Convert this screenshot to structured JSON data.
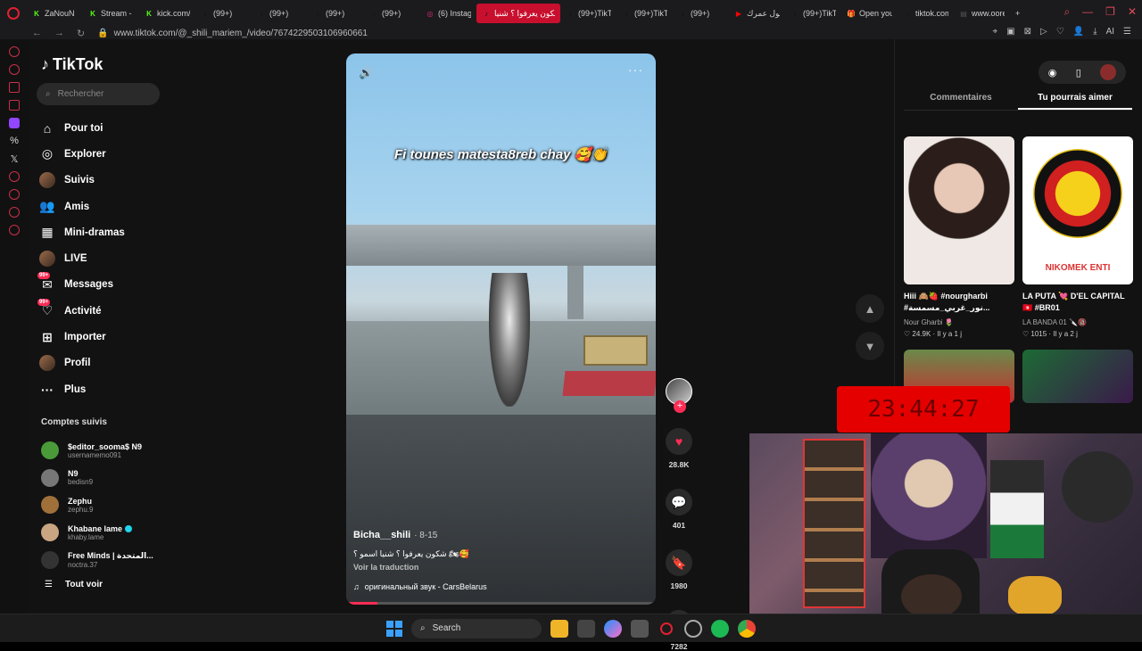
{
  "browser": {
    "tabs": [
      {
        "label": "ZaNouN",
        "fav": "K",
        "color": "#53fc18"
      },
      {
        "label": "Stream - K",
        "fav": "K",
        "color": "#53fc18"
      },
      {
        "label": "kick.com/",
        "fav": "K",
        "color": "#53fc18"
      },
      {
        "label": "(99+)",
        "fav": "♪",
        "color": "#111"
      },
      {
        "label": "(99+)",
        "fav": "♪",
        "color": "#111"
      },
      {
        "label": "(99+)",
        "fav": "♪",
        "color": "#111"
      },
      {
        "label": "(99+)",
        "fav": "♪",
        "color": "#111"
      },
      {
        "label": "(6) Instag",
        "fav": "◎",
        "color": "#d62976"
      },
      {
        "label": "شكون يعرفوا ؟ شنيا",
        "fav": "♪",
        "color": "#111",
        "active": true
      },
      {
        "label": "(99+)TikT",
        "fav": "♪",
        "color": "#111"
      },
      {
        "label": "(99+)TikT",
        "fav": "♪",
        "color": "#111"
      },
      {
        "label": "(99+)",
        "fav": "♪",
        "color": "#111"
      },
      {
        "label": "طول عمرك",
        "fav": "▶",
        "color": "#ff0000"
      },
      {
        "label": "(99+)TikT",
        "fav": "♪",
        "color": "#111"
      },
      {
        "label": "Open you",
        "fav": "🎁",
        "color": "#e33"
      },
      {
        "label": "tiktok.com",
        "fav": "♪",
        "color": "#111"
      },
      {
        "label": "www.oore",
        "fav": "▤",
        "color": "#555"
      }
    ],
    "url": "www.tiktok.com/@_shili_mariem_/video/7674229503106960661"
  },
  "tiktok": {
    "logo": "TikTok",
    "search_placeholder": "Rechercher",
    "nav": [
      {
        "label": "Pour toi",
        "icon": "⌂"
      },
      {
        "label": "Explorer",
        "icon": "◎"
      },
      {
        "label": "Suivis",
        "icon": "avatar"
      },
      {
        "label": "Amis",
        "icon": "👥"
      },
      {
        "label": "Mini-dramas",
        "icon": "▦"
      },
      {
        "label": "LIVE",
        "icon": "avatar"
      },
      {
        "label": "Messages",
        "icon": "✉",
        "badge": "99+"
      },
      {
        "label": "Activité",
        "icon": "♡",
        "badge": "99+"
      },
      {
        "label": "Importer",
        "icon": "⊞"
      },
      {
        "label": "Profil",
        "icon": "avatar"
      },
      {
        "label": "Plus",
        "icon": "···"
      }
    ],
    "following_title": "Comptes suivis",
    "following": [
      {
        "name": "$editor_sooma$ N9",
        "handle": "usernamemo091",
        "color": "#4a9a3a"
      },
      {
        "name": "N9",
        "handle": "bedisn9",
        "color": "#777"
      },
      {
        "name": "Zephu",
        "handle": "zephu.9",
        "color": "#a0703a"
      },
      {
        "name": "Khabane lame",
        "handle": "khaby.lame",
        "color": "#c9a582",
        "verified": true
      },
      {
        "name": "Free Minds | المتحدة...",
        "handle": "noctra.37",
        "color": "#333"
      }
    ],
    "see_all": "Tout voir"
  },
  "video": {
    "overlay_text": "Fi tounes matesta8reb chay 🥰👏",
    "author": "Bicha__shili",
    "date": "· 8-15",
    "caption": "شكون يعرفوا ؟ شنيا اسمو ؟ 🏍🥰",
    "translate": "Voir la traduction",
    "sound": "оригинальный звук - CarsBelarus",
    "progress": 0.1
  },
  "actions": {
    "likes": "28.8K",
    "comments": "401",
    "saves": "1980",
    "shares": "7282"
  },
  "right": {
    "tab_comments": "Commentaires",
    "tab_suggest": "Tu pourrais aimer",
    "cards": [
      {
        "title": "Hiii 🙈🍓 #nourgharbi #نور_غربي_مسمسة...",
        "author": "Nour Gharbi 🌷",
        "meta": "♡ 24.9K · Il y a 1 j"
      },
      {
        "title": "LA PUTA 💘 D'EL CAPITAL 🇹🇳 #BR01",
        "author": "LA BANDA 01 🔪🔞",
        "meta": "♡ 1015 · Il y a 2 j",
        "badge_text": "NIKOMEK ENTI"
      }
    ]
  },
  "overlay": {
    "timer": "23:44:27"
  },
  "taskbar": {
    "search": "Search"
  }
}
